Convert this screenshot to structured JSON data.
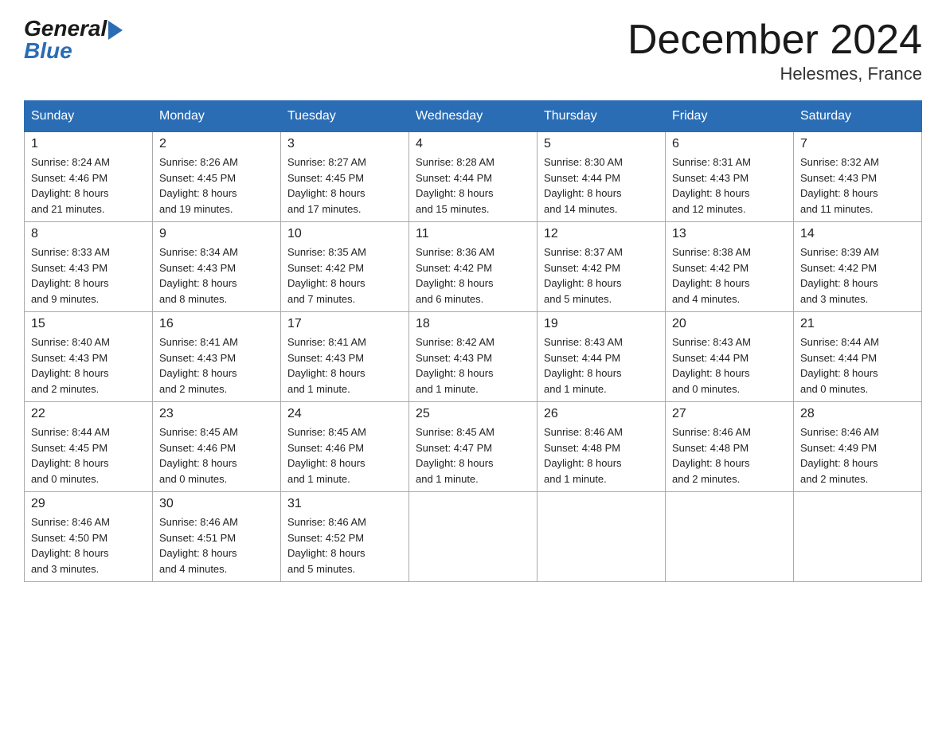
{
  "logo": {
    "general": "General",
    "blue": "Blue"
  },
  "title": "December 2024",
  "location": "Helesmes, France",
  "days_of_week": [
    "Sunday",
    "Monday",
    "Tuesday",
    "Wednesday",
    "Thursday",
    "Friday",
    "Saturday"
  ],
  "weeks": [
    [
      {
        "day": "1",
        "sunrise": "8:24 AM",
        "sunset": "4:46 PM",
        "daylight": "8 hours and 21 minutes."
      },
      {
        "day": "2",
        "sunrise": "8:26 AM",
        "sunset": "4:45 PM",
        "daylight": "8 hours and 19 minutes."
      },
      {
        "day": "3",
        "sunrise": "8:27 AM",
        "sunset": "4:45 PM",
        "daylight": "8 hours and 17 minutes."
      },
      {
        "day": "4",
        "sunrise": "8:28 AM",
        "sunset": "4:44 PM",
        "daylight": "8 hours and 15 minutes."
      },
      {
        "day": "5",
        "sunrise": "8:30 AM",
        "sunset": "4:44 PM",
        "daylight": "8 hours and 14 minutes."
      },
      {
        "day": "6",
        "sunrise": "8:31 AM",
        "sunset": "4:43 PM",
        "daylight": "8 hours and 12 minutes."
      },
      {
        "day": "7",
        "sunrise": "8:32 AM",
        "sunset": "4:43 PM",
        "daylight": "8 hours and 11 minutes."
      }
    ],
    [
      {
        "day": "8",
        "sunrise": "8:33 AM",
        "sunset": "4:43 PM",
        "daylight": "8 hours and 9 minutes."
      },
      {
        "day": "9",
        "sunrise": "8:34 AM",
        "sunset": "4:43 PM",
        "daylight": "8 hours and 8 minutes."
      },
      {
        "day": "10",
        "sunrise": "8:35 AM",
        "sunset": "4:42 PM",
        "daylight": "8 hours and 7 minutes."
      },
      {
        "day": "11",
        "sunrise": "8:36 AM",
        "sunset": "4:42 PM",
        "daylight": "8 hours and 6 minutes."
      },
      {
        "day": "12",
        "sunrise": "8:37 AM",
        "sunset": "4:42 PM",
        "daylight": "8 hours and 5 minutes."
      },
      {
        "day": "13",
        "sunrise": "8:38 AM",
        "sunset": "4:42 PM",
        "daylight": "8 hours and 4 minutes."
      },
      {
        "day": "14",
        "sunrise": "8:39 AM",
        "sunset": "4:42 PM",
        "daylight": "8 hours and 3 minutes."
      }
    ],
    [
      {
        "day": "15",
        "sunrise": "8:40 AM",
        "sunset": "4:43 PM",
        "daylight": "8 hours and 2 minutes."
      },
      {
        "day": "16",
        "sunrise": "8:41 AM",
        "sunset": "4:43 PM",
        "daylight": "8 hours and 2 minutes."
      },
      {
        "day": "17",
        "sunrise": "8:41 AM",
        "sunset": "4:43 PM",
        "daylight": "8 hours and 1 minute."
      },
      {
        "day": "18",
        "sunrise": "8:42 AM",
        "sunset": "4:43 PM",
        "daylight": "8 hours and 1 minute."
      },
      {
        "day": "19",
        "sunrise": "8:43 AM",
        "sunset": "4:44 PM",
        "daylight": "8 hours and 1 minute."
      },
      {
        "day": "20",
        "sunrise": "8:43 AM",
        "sunset": "4:44 PM",
        "daylight": "8 hours and 0 minutes."
      },
      {
        "day": "21",
        "sunrise": "8:44 AM",
        "sunset": "4:44 PM",
        "daylight": "8 hours and 0 minutes."
      }
    ],
    [
      {
        "day": "22",
        "sunrise": "8:44 AM",
        "sunset": "4:45 PM",
        "daylight": "8 hours and 0 minutes."
      },
      {
        "day": "23",
        "sunrise": "8:45 AM",
        "sunset": "4:46 PM",
        "daylight": "8 hours and 0 minutes."
      },
      {
        "day": "24",
        "sunrise": "8:45 AM",
        "sunset": "4:46 PM",
        "daylight": "8 hours and 1 minute."
      },
      {
        "day": "25",
        "sunrise": "8:45 AM",
        "sunset": "4:47 PM",
        "daylight": "8 hours and 1 minute."
      },
      {
        "day": "26",
        "sunrise": "8:46 AM",
        "sunset": "4:48 PM",
        "daylight": "8 hours and 1 minute."
      },
      {
        "day": "27",
        "sunrise": "8:46 AM",
        "sunset": "4:48 PM",
        "daylight": "8 hours and 2 minutes."
      },
      {
        "day": "28",
        "sunrise": "8:46 AM",
        "sunset": "4:49 PM",
        "daylight": "8 hours and 2 minutes."
      }
    ],
    [
      {
        "day": "29",
        "sunrise": "8:46 AM",
        "sunset": "4:50 PM",
        "daylight": "8 hours and 3 minutes."
      },
      {
        "day": "30",
        "sunrise": "8:46 AM",
        "sunset": "4:51 PM",
        "daylight": "8 hours and 4 minutes."
      },
      {
        "day": "31",
        "sunrise": "8:46 AM",
        "sunset": "4:52 PM",
        "daylight": "8 hours and 5 minutes."
      },
      null,
      null,
      null,
      null
    ]
  ],
  "labels": {
    "sunrise": "Sunrise:",
    "sunset": "Sunset:",
    "daylight": "Daylight:"
  }
}
